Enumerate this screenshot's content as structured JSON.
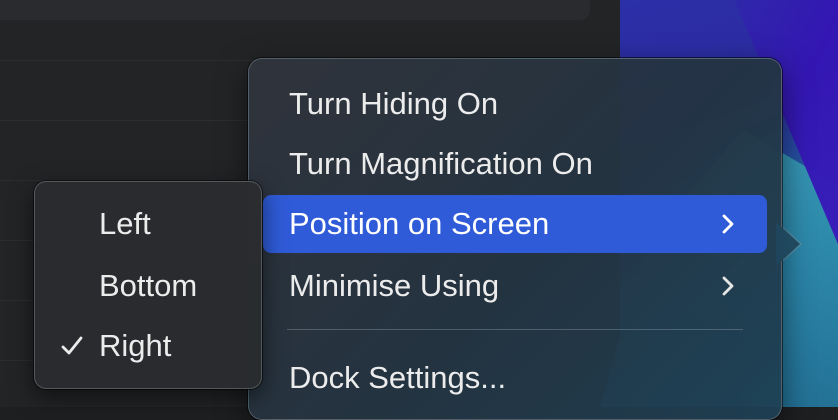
{
  "menu": {
    "items": [
      {
        "label": "Turn Hiding On",
        "submenu": false,
        "active": false
      },
      {
        "label": "Turn Magnification On",
        "submenu": false,
        "active": false
      },
      {
        "label": "Position on Screen",
        "submenu": true,
        "active": true
      },
      {
        "label": "Minimise Using",
        "submenu": true,
        "active": false
      }
    ],
    "settings_label": "Dock Settings..."
  },
  "submenu": {
    "items": [
      {
        "label": "Left",
        "checked": false
      },
      {
        "label": "Bottom",
        "checked": false
      },
      {
        "label": "Right",
        "checked": true
      }
    ]
  },
  "colors": {
    "highlight": "#2f5bd8",
    "menu_text": "#ececec"
  }
}
